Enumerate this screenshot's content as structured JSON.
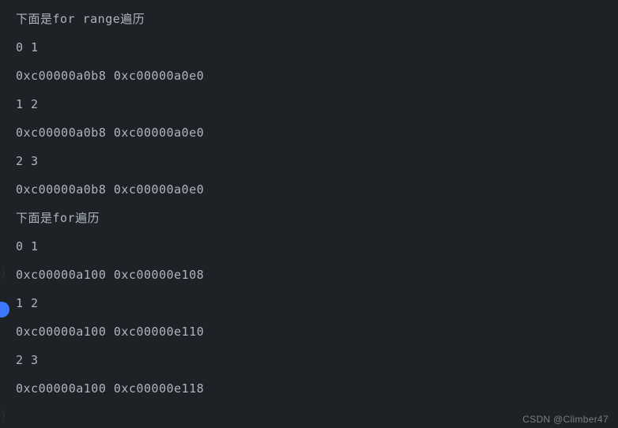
{
  "terminal": {
    "lines": [
      "下面是for range遍历",
      "0 1",
      "0xc00000a0b8 0xc00000a0e0",
      "1 2",
      "0xc00000a0b8 0xc00000a0e0",
      "2 3",
      "0xc00000a0b8 0xc00000a0e0",
      "下面是for遍历",
      "0 1",
      "0xc00000a100 0xc00000e108",
      "1 2",
      "0xc00000a100 0xc00000e110",
      "2 3",
      "0xc00000a100 0xc00000e118"
    ]
  },
  "gutter": {
    "chevron": "⟩"
  },
  "watermark": "CSDN @Climber47"
}
